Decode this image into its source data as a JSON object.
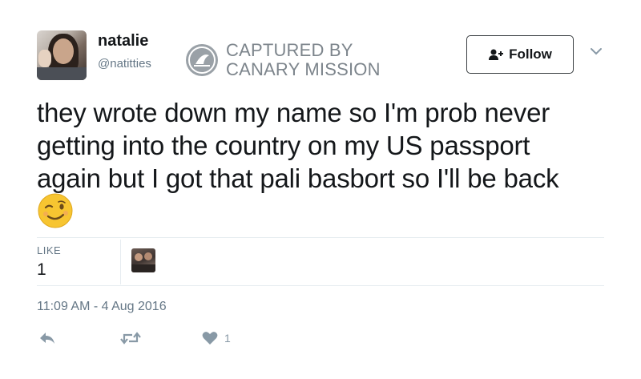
{
  "author": {
    "display_name": "natalie",
    "handle": "@natitties"
  },
  "watermark": {
    "line1": "CAPTURED BY",
    "line2": "CANARY MISSION"
  },
  "follow_button": {
    "label": "Follow"
  },
  "tweet": {
    "line1": "they wrote down my name so I'm prob never",
    "line2": "getting into the country on my US passport",
    "line3": "again but I got that pali basbort so I'll be back",
    "emoji": "winking-face"
  },
  "stats": {
    "likes_label": "LIKE",
    "likes_count": "1"
  },
  "timestamp": "11:09 AM - 4 Aug 2016",
  "actions": {
    "like_count": "1"
  },
  "colors": {
    "text": "#14171a",
    "muted": "#657786",
    "icon": "#8899a6",
    "divider": "#e6ecf0",
    "watermark": "#7d858c"
  }
}
